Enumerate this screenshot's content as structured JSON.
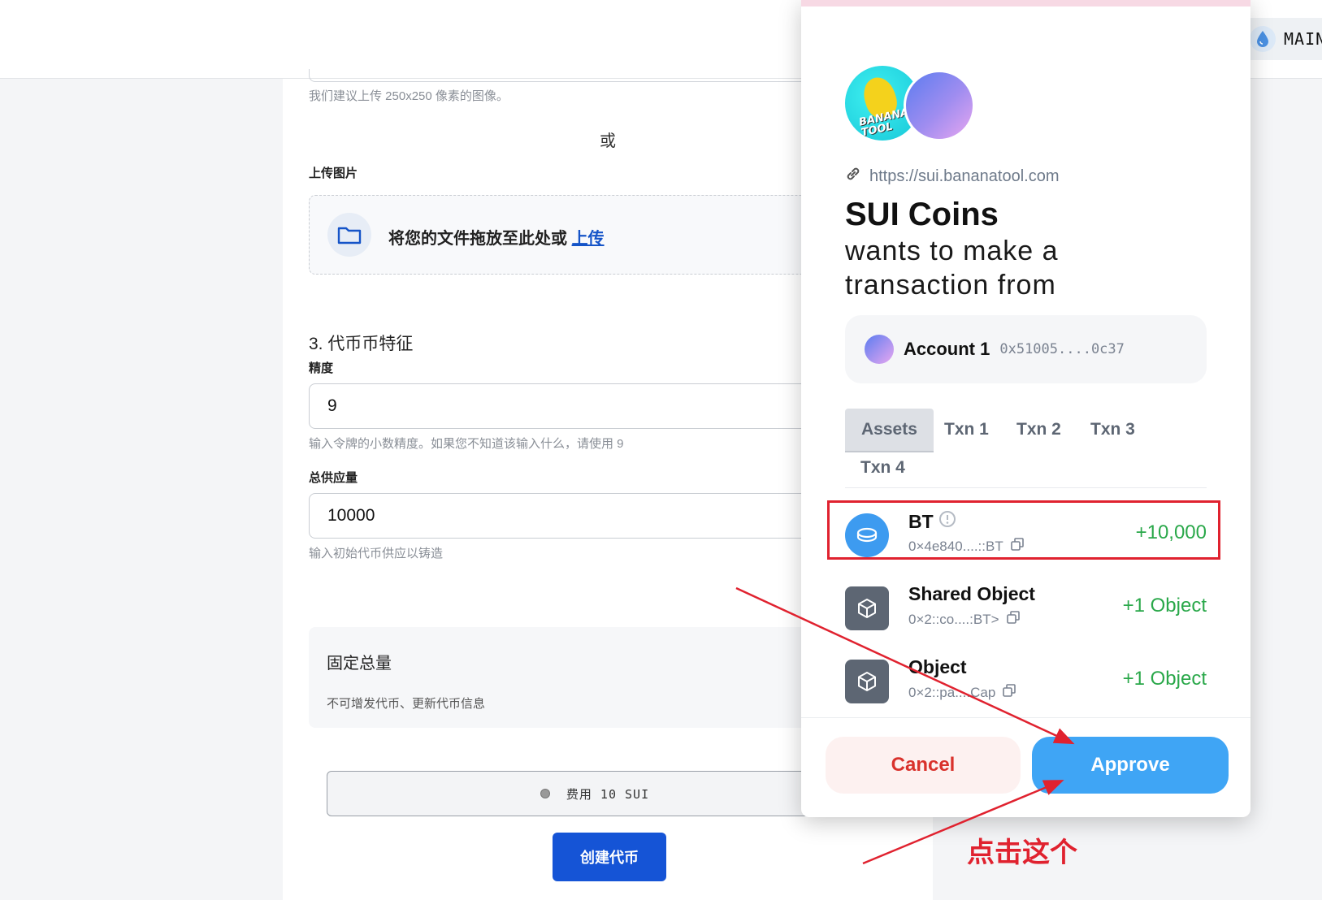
{
  "topbar": {
    "network_label": "MAIN",
    "network_icon": "water-drop-icon"
  },
  "form": {
    "image_hint": "我们建议上传 250x250 像素的图像。",
    "or_text": "或",
    "upload_label": "上传图片",
    "dropzone_text": "将您的文件拖放至此处或",
    "dropzone_link": "上传",
    "section_title": "3. 代币币特征",
    "precision_label": "精度",
    "precision_value": "9",
    "precision_hint": "输入令牌的小数精度。如果您不知道该输入什么，请使用 9",
    "supply_label": "总供应量",
    "supply_value": "10000",
    "supply_hint": "输入初始代币供应以铸造",
    "fixed_title": "固定总量",
    "fixed_desc": "不可增发代币、更新代币信息",
    "fee_text": "费用 10 SUI",
    "create_button": "创建代币"
  },
  "wallet": {
    "logo_text": "BANANA TOOL",
    "site_url": "https://sui.bananatool.com",
    "app_name": "SUI Coins",
    "app_sub": "wants to make a transaction from",
    "account": {
      "name": "Account 1",
      "address": "0x51005....0c37"
    },
    "tabs": [
      "Assets",
      "Txn 1",
      "Txn 2",
      "Txn 3",
      "Txn 4"
    ],
    "active_tab": "Assets",
    "assets": [
      {
        "name": "BT",
        "address": "0×4e840....::BT",
        "amount": "+10,000",
        "icon": "coin-icon"
      },
      {
        "name": "Shared Object",
        "address": "0×2::co....:BT>",
        "amount": "+1 Object",
        "icon": "cube-icon"
      },
      {
        "name": "Object",
        "address": "0×2::pa....Cap",
        "amount": "+1 Object",
        "icon": "cube-icon"
      }
    ],
    "cancel_button": "Cancel",
    "approve_button": "Approve"
  },
  "annotation": {
    "note": "点击这个",
    "color": "#e0222f"
  }
}
